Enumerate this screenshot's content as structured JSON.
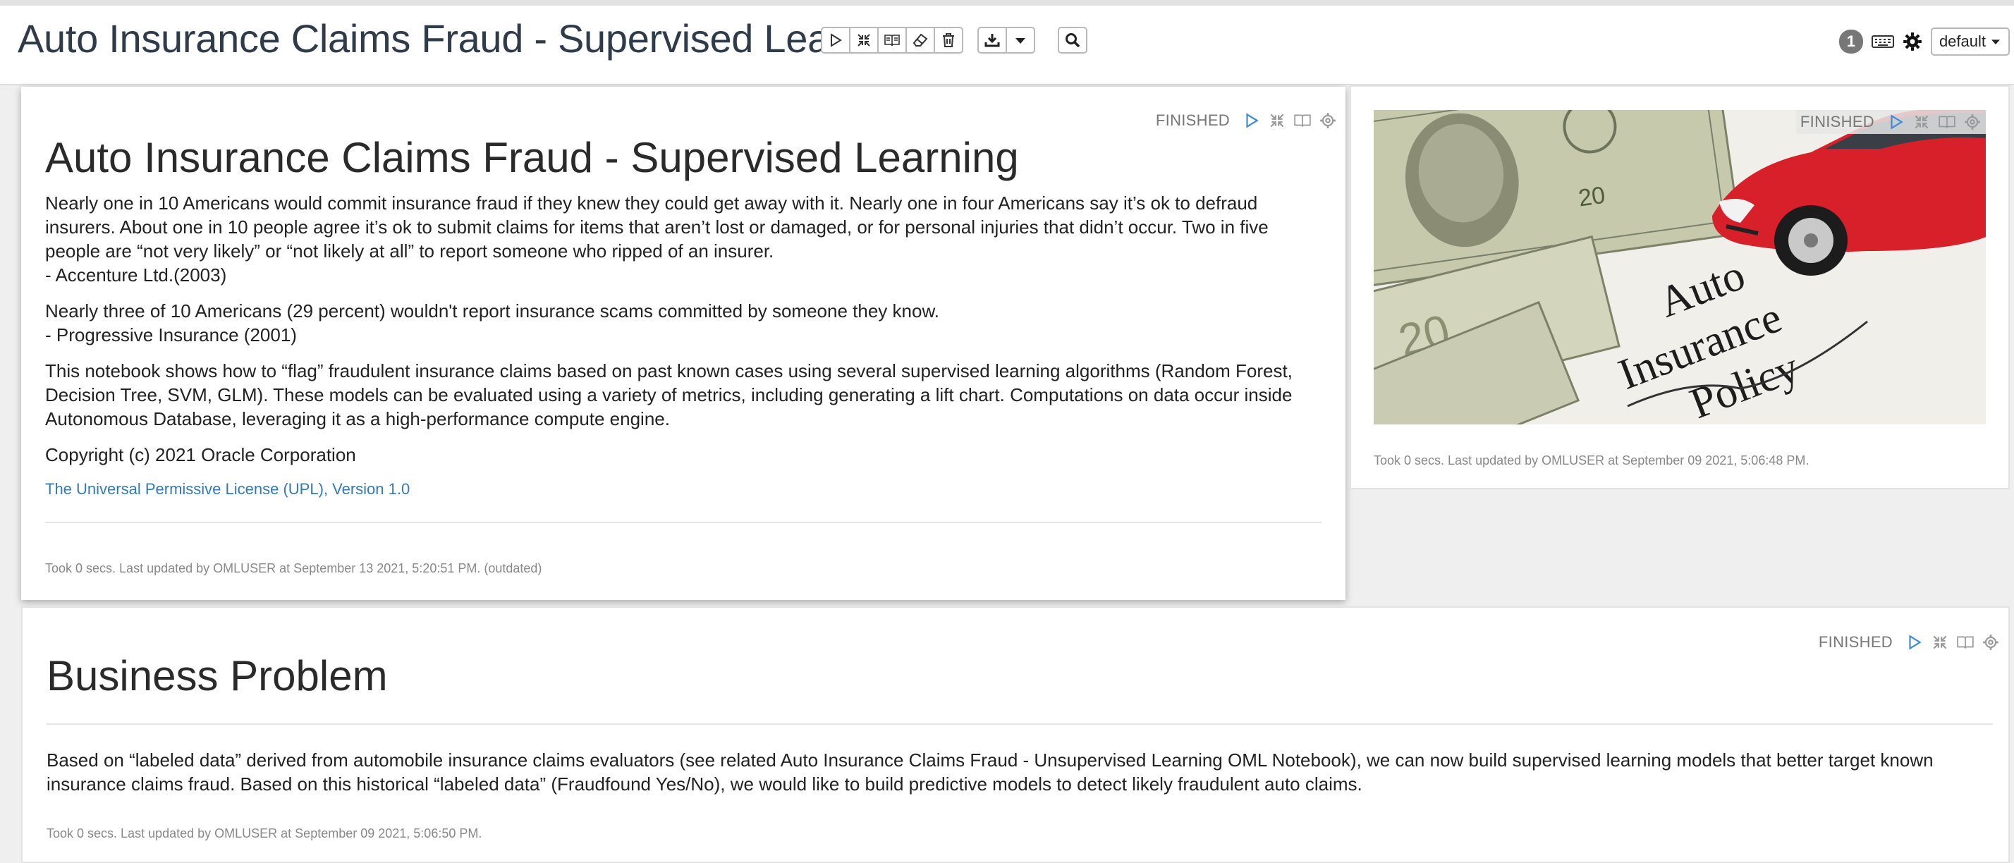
{
  "header": {
    "notebook_title": "Auto Insurance Claims Fraud - Supervised Lea...",
    "badge_count": "1",
    "interpreter_label": "default"
  },
  "icons": {
    "run": "play-icon",
    "hide_output": "collapse-icon",
    "hide_code": "book-icon",
    "clear_output": "eraser-icon",
    "delete": "trash-icon",
    "export": "download-icon",
    "export_menu": "caret-down-icon",
    "search": "search-icon",
    "keyboard": "keyboard-icon",
    "settings": "gear-icon"
  },
  "paragraphs": [
    {
      "status": "FINISHED",
      "title": "Auto Insurance Claims Fraud - Supervised Learning",
      "p1": "Nearly one in 10 Americans would commit insurance fraud if they knew they could get away with it. Nearly one in four Americans say it’s ok to defraud insurers. About one in 10 people agree it’s ok to submit claims for items that aren’t lost or damaged, or for personal injuries that didn’t occur. Two in five people are “not very likely” or “not likely at all” to report someone who ripped of an insurer.",
      "p1_source": "- Accenture Ltd.(2003)",
      "p2": "Nearly three of 10 Americans (29 percent) wouldn't report insurance scams committed by someone they know.",
      "p2_source": "- Progressive Insurance (2001)",
      "p3": "This notebook shows how to “flag” fraudulent insurance claims based on past known cases using several supervised learning algorithms (Random Forest, Decision Tree, SVM, GLM). These models can be evaluated using a variety of metrics, including generating a lift chart. Computations on data occur inside Autonomous Database, leveraging it as a high-performance compute engine.",
      "copyright": "Copyright (c) 2021 Oracle Corporation",
      "license_link": "The Universal Permissive License (UPL), Version 1.0",
      "footer": "Took 0 secs. Last updated by OMLUSER at September 13 2021, 5:20:51 PM. (outdated)"
    },
    {
      "status": "FINISHED",
      "image_text": [
        "Auto",
        "Insurance",
        "Policy"
      ],
      "footer": "Took 0 secs. Last updated by OMLUSER at September 09 2021, 5:06:48 PM."
    },
    {
      "status": "FINISHED",
      "title": "Business Problem",
      "p1": "Based on “labeled data” derived from automobile insurance claims evaluators (see related Auto Insurance Claims Fraud - Unsupervised Learning OML Notebook), we can now build supervised learning models that better target known insurance claims fraud. Based on this historical “labeled data” (Fraudfound Yes/No), we would like to build predictive models to detect likely fraudulent auto claims.",
      "footer": "Took 0 secs. Last updated by OMLUSER at September 09 2021, 5:06:50 PM."
    }
  ]
}
